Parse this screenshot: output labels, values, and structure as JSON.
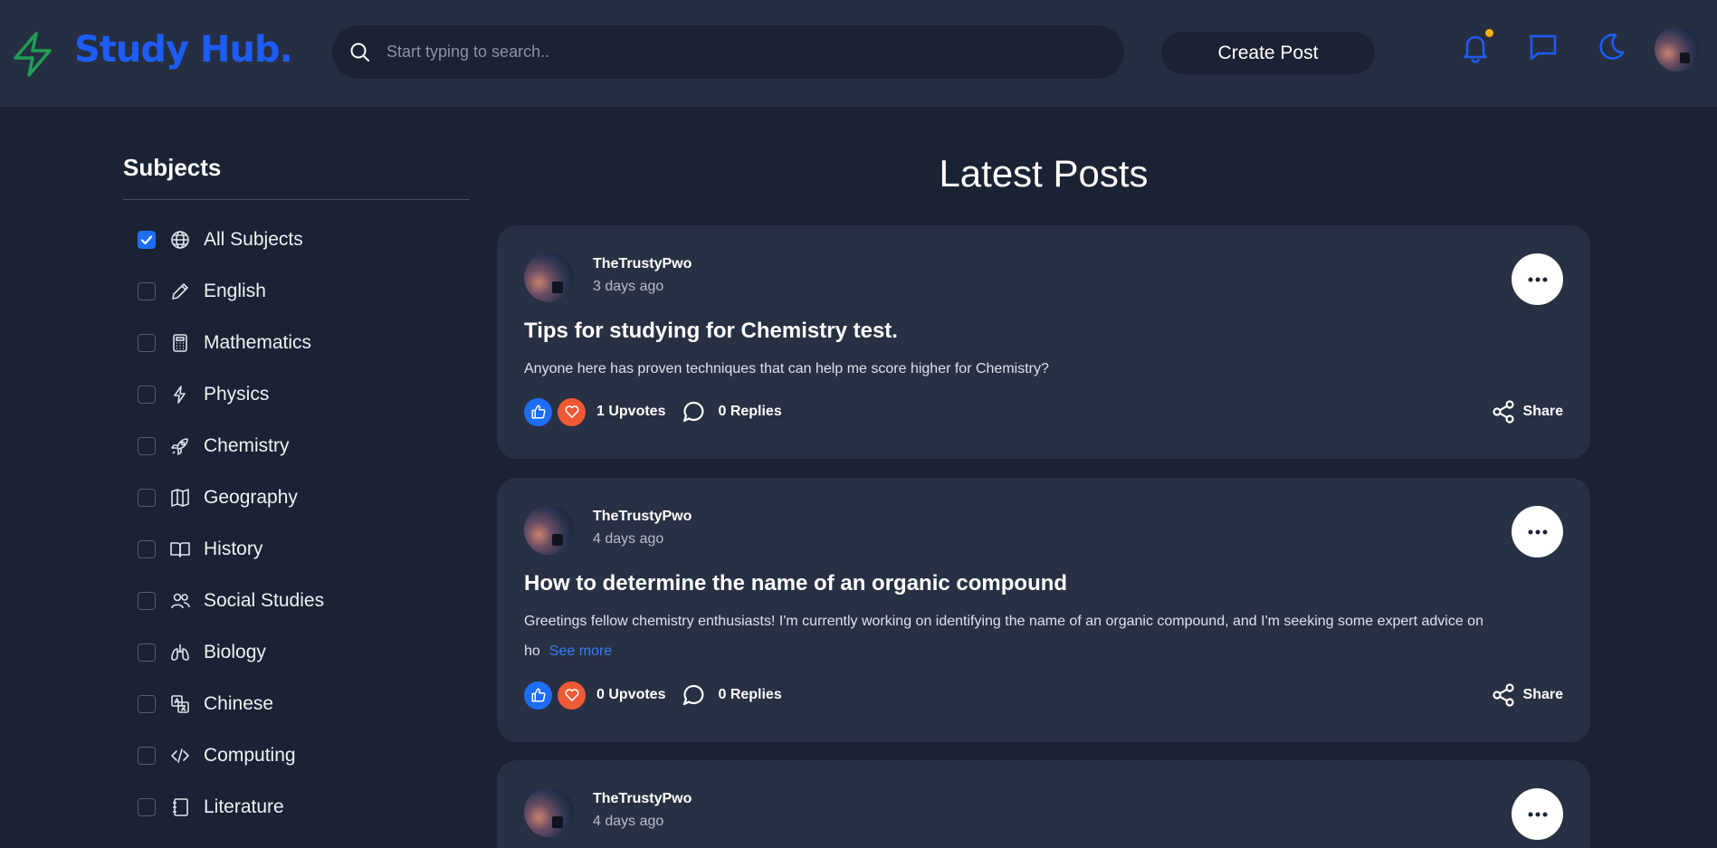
{
  "header": {
    "logo_text": "Study Hub.",
    "search_placeholder": "Start typing to search..",
    "create_post_label": "Create Post",
    "icons": [
      "bell-icon",
      "chat-icon",
      "moon-icon"
    ],
    "notification_dot_color": "#f5b500"
  },
  "sidebar": {
    "title": "Subjects",
    "items": [
      {
        "label": "All Subjects",
        "checked": true,
        "icon": "globe-icon"
      },
      {
        "label": "English",
        "checked": false,
        "icon": "pencil-icon"
      },
      {
        "label": "Mathematics",
        "checked": false,
        "icon": "calculator-icon"
      },
      {
        "label": "Physics",
        "checked": false,
        "icon": "bolt-icon"
      },
      {
        "label": "Chemistry",
        "checked": false,
        "icon": "rocket-icon"
      },
      {
        "label": "Geography",
        "checked": false,
        "icon": "map-icon"
      },
      {
        "label": "History",
        "checked": false,
        "icon": "book-icon"
      },
      {
        "label": "Social Studies",
        "checked": false,
        "icon": "users-icon"
      },
      {
        "label": "Biology",
        "checked": false,
        "icon": "lungs-icon"
      },
      {
        "label": "Chinese",
        "checked": false,
        "icon": "translate-icon"
      },
      {
        "label": "Computing",
        "checked": false,
        "icon": "code-icon"
      },
      {
        "label": "Literature",
        "checked": false,
        "icon": "notebook-icon"
      }
    ]
  },
  "main": {
    "title": "Latest Posts",
    "posts": [
      {
        "author": "TheTrustyPwo",
        "time": "3 days ago",
        "title": "Tips for studying for Chemistry test.",
        "body": "Anyone here has proven techniques that can help me score higher for Chemistry?",
        "see_more": "",
        "upvotes": "1 Upvotes",
        "replies": "0 Replies",
        "share": "Share"
      },
      {
        "author": "TheTrustyPwo",
        "time": "4 days ago",
        "title": "How to determine the name of an organic compound",
        "body": "Greetings fellow chemistry enthusiasts! I'm currently working on identifying the name of an organic compound, and I'm seeking some expert advice on ho",
        "see_more": "See more",
        "upvotes": "0 Upvotes",
        "replies": "0 Replies",
        "share": "Share"
      },
      {
        "author": "TheTrustyPwo",
        "time": "4 days ago"
      }
    ]
  },
  "colors": {
    "page_bg": "#1a2233",
    "header_bg": "#262f42",
    "card_bg": "#283043",
    "accent_blue": "#1d5cf5",
    "like_blue": "#1d6ef5",
    "love_orange": "#ef5a35",
    "logo_bolt_green": "#1f9e55"
  }
}
